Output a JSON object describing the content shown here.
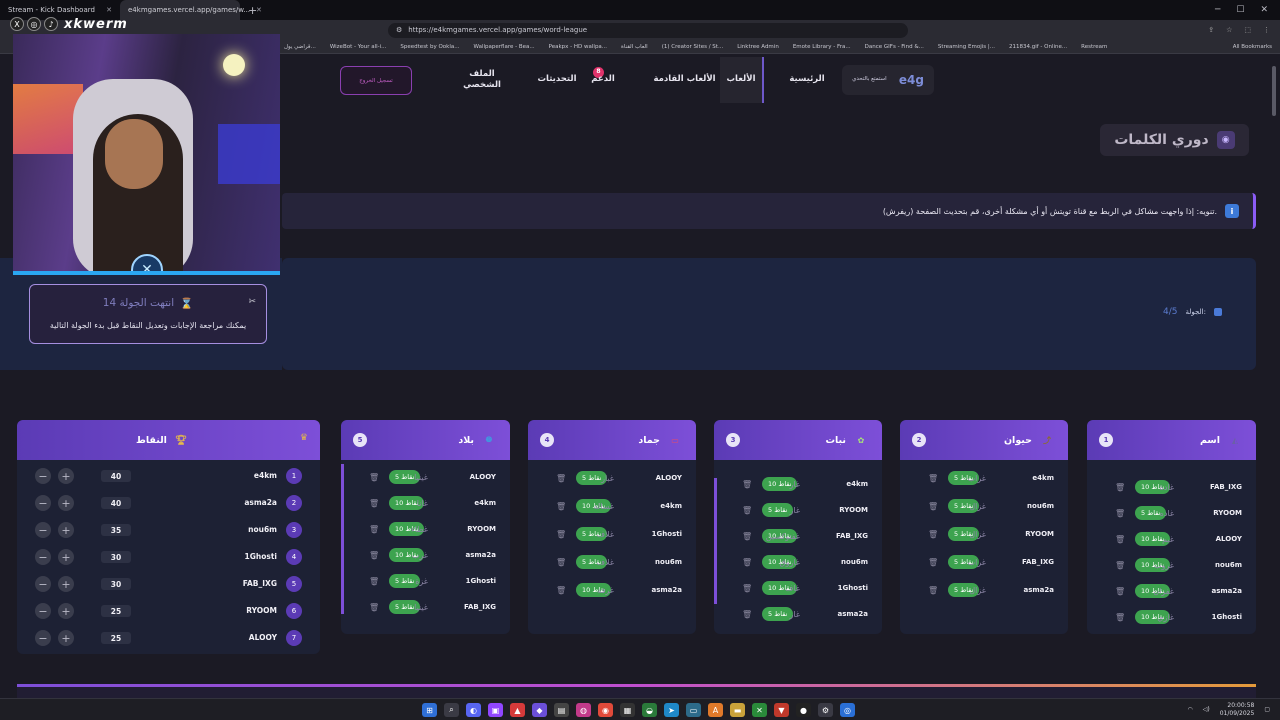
{
  "browser": {
    "tabs": [
      {
        "label": "Stream - Kick Dashboard"
      },
      {
        "label": "e4kmgames.vercel.app/games/w..."
      }
    ],
    "new_tab": "+",
    "url": "https://e4kmgames.vercel.app/games/word-league",
    "bookmarks": [
      "قراضي يول...",
      "WizeBot - Your all-i...",
      "Speedtest by Ookla...",
      "Wallpaperflare - Bea...",
      "Peakpx - HD wallpa...",
      "العاب القناة",
      "(1) Creator Sites / St...",
      "Linktree Admin",
      "Emote Library - Fra...",
      "Dance GIFs - Find &...",
      "Streaming Emojis |...",
      "211834.gif - Online...",
      "Restream"
    ],
    "all_bookmarks": "All Bookmarks"
  },
  "overlay": {
    "handle": "xkwerm"
  },
  "nav": {
    "register": "تسجيل الخروج",
    "profile": "الملف الشخصي",
    "challenges": "التحديثات",
    "challenges_badge": "8",
    "support": "الدعم",
    "upcoming": "الألعاب القادمة",
    "games": "الألعاب",
    "home": "الرئيسية",
    "brand_tag": "استمتع بالتحدي",
    "brand_logo": "e4g"
  },
  "page": {
    "title": "دوري الكلمات",
    "notice": "تنويه: إذا واجهت مشاكل في الربط مع قناة تويتش أو أي مشكلة أخرى، قم بتحديث الصفحة (ريفرش).",
    "round_label": "الجولة:",
    "round_value": "4/5",
    "round_end_title": "انتهت الجولة 14",
    "round_end_sub": "يمكنك مراجعة الإجابات وتعديل النقاط قبل بدء الجولة التالية"
  },
  "points": {
    "title": "النقاط",
    "rows": [
      {
        "rank": "1",
        "name": "e4km",
        "score": "40"
      },
      {
        "rank": "2",
        "name": "asma2a",
        "score": "40"
      },
      {
        "rank": "3",
        "name": "nou6m",
        "score": "35"
      },
      {
        "rank": "4",
        "name": "1Ghosti",
        "score": "30"
      },
      {
        "rank": "5",
        "name": "FAB_IXG",
        "score": "30"
      },
      {
        "rank": "6",
        "name": "RYOOM",
        "score": "25"
      },
      {
        "rank": "7",
        "name": "ALOOY",
        "score": "25"
      }
    ]
  },
  "columns": [
    {
      "num": "5",
      "title": "بلاد",
      "rows": [
        {
          "pts": "5 نقاط",
          "ans": "غينيا",
          "who": "ALOOY"
        },
        {
          "pts": "10 نقاط",
          "ans": "غانا",
          "who": "e4km"
        },
        {
          "pts": "10 نقاط",
          "ans": "غطاء",
          "who": "RYOOM"
        },
        {
          "pts": "10 نقاط",
          "ans": "غرب",
          "who": "asma2a"
        },
        {
          "pts": "5 نقاط",
          "ans": "غزة",
          "who": "1Ghosti"
        },
        {
          "pts": "5 نقاط",
          "ans": "غينيا",
          "who": "FAB_IXG"
        }
      ]
    },
    {
      "num": "4",
      "title": "جماد",
      "rows": [
        {
          "pts": "5 نقاط",
          "ans": "غبار",
          "who": "ALOOY"
        },
        {
          "pts": "10 نقاط",
          "ans": "غسالة",
          "who": "e4km"
        },
        {
          "pts": "5 نقاط",
          "ans": "غلاف",
          "who": "1Ghosti"
        },
        {
          "pts": "5 نقاط",
          "ans": "غلاف",
          "who": "nou6m"
        },
        {
          "pts": "10 نقاط",
          "ans": "غرفة",
          "who": "asma2a"
        }
      ]
    },
    {
      "num": "3",
      "title": "نبات",
      "rows": [
        {
          "pts": "10 نقاط",
          "ans": "غار",
          "who": "e4km"
        },
        {
          "pts": "5 نقاط",
          "ans": "غار",
          "who": "RYOOM"
        },
        {
          "pts": "10 نقاط",
          "ans": "غفتوكسين",
          "who": "FAB_IXG"
        },
        {
          "pts": "10 نقاط",
          "ans": "غاروق",
          "who": "nou6m"
        },
        {
          "pts": "10 نقاط",
          "ans": "غاف",
          "who": "1Ghosti"
        },
        {
          "pts": "5 نقاط",
          "ans": "غار",
          "who": "asma2a"
        }
      ]
    },
    {
      "num": "2",
      "title": "حيوان",
      "rows": [
        {
          "pts": "5 نقاط",
          "ans": "غراب",
          "who": "e4km"
        },
        {
          "pts": "5 نقاط",
          "ans": "غزال",
          "who": "nou6m"
        },
        {
          "pts": "5 نقاط",
          "ans": "غزال",
          "who": "RYOOM"
        },
        {
          "pts": "5 نقاط",
          "ans": "غراب",
          "who": "FAB_IXG"
        },
        {
          "pts": "5 نقاط",
          "ans": "غزال",
          "who": "asma2a"
        }
      ]
    },
    {
      "num": "1",
      "title": "اسم",
      "rows": [
        {
          "pts": "10 نقاط",
          "ans": "غادة",
          "who": "FAB_IXG"
        },
        {
          "pts": "5 نقاط",
          "ans": "غاده",
          "who": "RYOOM"
        },
        {
          "pts": "10 نقاط",
          "ans": "غيم",
          "who": "ALOOY"
        },
        {
          "pts": "10 نقاط",
          "ans": "غروب",
          "who": "nou6m"
        },
        {
          "pts": "10 نقاط",
          "ans": "غفران",
          "who": "asma2a"
        },
        {
          "pts": "10 نقاط",
          "ans": "غازي",
          "who": "1Ghosti"
        }
      ]
    }
  ],
  "taskbar": {
    "time": "20:00:58",
    "date": "01/09/2025"
  }
}
